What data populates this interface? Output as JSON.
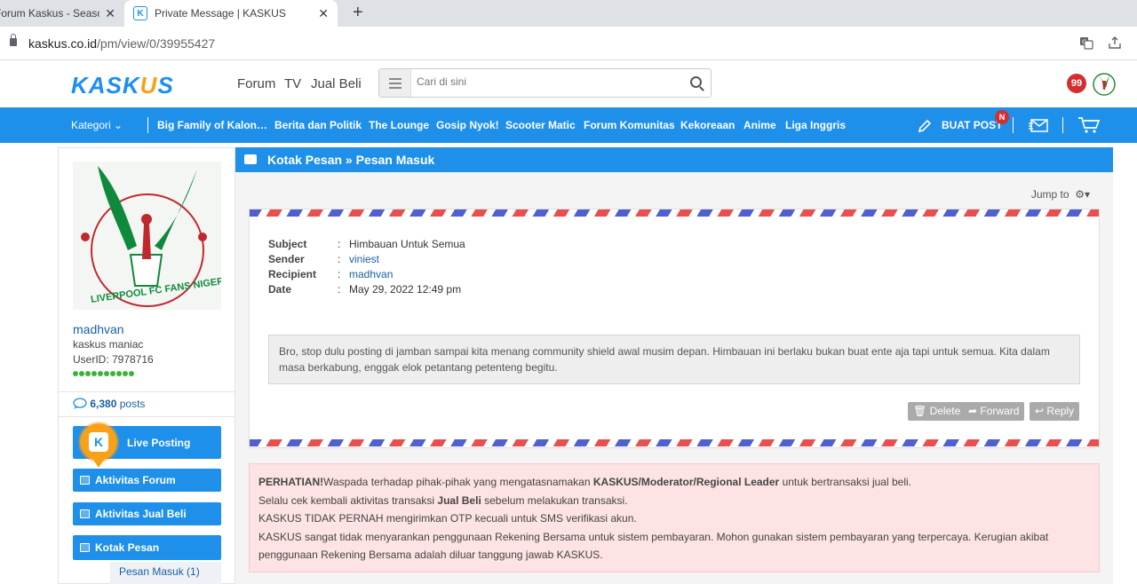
{
  "browser": {
    "tabs": [
      {
        "title": "Forum Kaskus - Season",
        "close": "✕"
      },
      {
        "title": "Private Message | KASKUS",
        "close": "✕"
      }
    ],
    "new_tab": "+",
    "url_host": "kaskus.co.id",
    "url_path": "/pm/view/0/39955427"
  },
  "header": {
    "logo_left": "KASK",
    "logo_o": "U",
    "logo_right": "S",
    "nav": [
      "Forum",
      "TV",
      "Jual Beli"
    ],
    "search_placeholder": "Cari di sini",
    "notification_count": "99"
  },
  "navbar": {
    "kategori": "Kategori",
    "items": [
      "Big Family of Kalon…",
      "Berita dan Politik",
      "The Lounge",
      "Gosip Nyok!",
      "Scooter Matic",
      "Forum Komunitas",
      "Kekoreaan",
      "Anime",
      "Liga Inggris"
    ],
    "buat_post": "BUAT POST",
    "buat_post_badge": "N"
  },
  "sidebar": {
    "username": "madhvan",
    "rank": "kaskus maniac",
    "user_id": "UserID: 7978716",
    "posts_count": "6,380",
    "posts_label": "posts",
    "buttons": {
      "live_posting": "Live Posting",
      "aktivitas_forum": "Aktivitas Forum",
      "aktivitas_jual_beli": "Aktivitas Jual Beli",
      "kotak_pesan": "Kotak Pesan"
    },
    "sub_item": "Pesan Masuk (1)"
  },
  "main": {
    "title": "Kotak Pesan » Pesan Masuk",
    "jump_to": "Jump to",
    "message": {
      "fields": [
        {
          "label": "Subject",
          "value": "Himbauan Untuk Semua"
        },
        {
          "label": "Sender",
          "value": "viniest"
        },
        {
          "label": "Recipient",
          "value": "madhvan"
        },
        {
          "label": "Date",
          "value": "May 29, 2022 12:49 pm"
        }
      ],
      "body": "Bro, stop dulu posting di jamban sampai kita menang community shield awal musim depan. Himbauan ini berlaku bukan buat ente aja tapi untuk semua. Kita dalam masa berkabung, enggak elok petantang petenteng begitu."
    },
    "actions": {
      "delete": "Delete",
      "forward": "Forward",
      "reply": "Reply"
    },
    "warning": {
      "l1_bold": "PERHATIAN!",
      "l1_a": "Waspada terhadap pihak-pihak yang mengatasnamakan ",
      "l1_b": "KASKUS/Moderator/Regional Leader",
      "l1_c": " untuk bertransaksi jual beli.",
      "l2_a": "Selalu cek kembali aktivitas transaksi ",
      "l2_b": "Jual Beli",
      "l2_c": " sebelum melakukan transaksi.",
      "l3": "KASKUS TIDAK PERNAH mengirimkan OTP kecuali untuk SMS verifikasi akun.",
      "l4": "KASKUS sangat tidak menyarankan penggunaan Rekening Bersama untuk sistem pembayaran. Mohon gunakan sistem pembayaran yang terpercaya. Kerugian akibat penggunaan Rekening Bersama adalah diluar tanggung jawab KASKUS."
    }
  },
  "colors": {
    "brand_blue": "#1e90ea",
    "brand_orange": "#f7a11a",
    "warning_bg": "#fde3e3"
  }
}
